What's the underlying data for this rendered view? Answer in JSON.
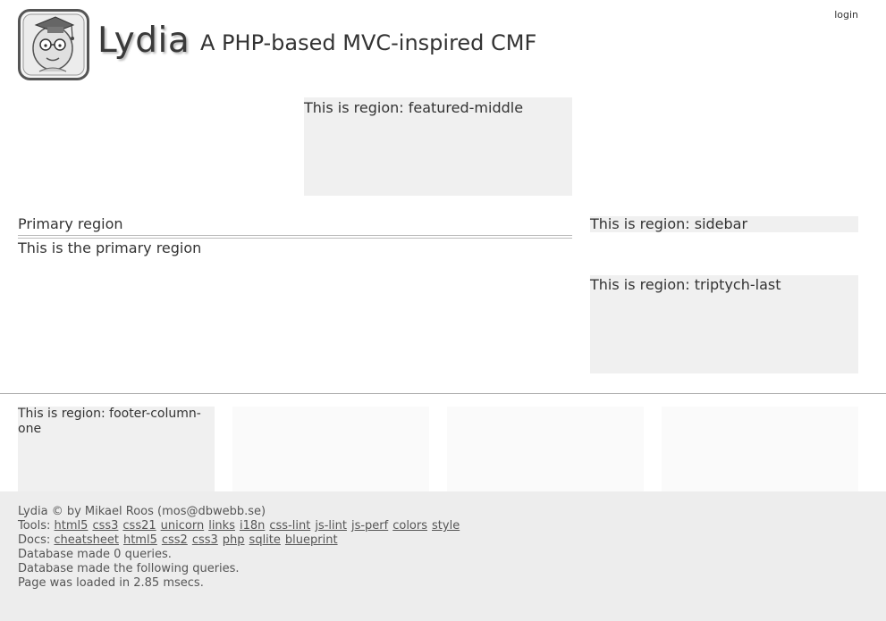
{
  "header": {
    "site_title": "Lydia",
    "slogan": "A PHP-based MVC-inspired CMF",
    "login_label": "login",
    "logo_icon": "graduate-face-logo-icon"
  },
  "regions": {
    "featured_middle": "This is region: featured-middle",
    "primary_title": "Primary region",
    "primary_content": "This is the primary region",
    "sidebar": "This is region: sidebar",
    "triptych_last": "This is region: triptych-last",
    "footer_column_one": "This is region: footer-column-one"
  },
  "footer": {
    "credit": "Lydia © by Mikael Roos (mos@dbwebb.se)",
    "tools_label": "Tools:",
    "tools_links": [
      "html5",
      "css3",
      "css21",
      "unicorn",
      "links",
      "i18n",
      "css-lint",
      "js-lint",
      "js-perf",
      "colors",
      "style"
    ],
    "docs_label": "Docs:",
    "docs_links": [
      "cheatsheet",
      "html5",
      "css2",
      "css3",
      "php",
      "sqlite",
      "blueprint"
    ],
    "db_queries_count": "Database made 0 queries.",
    "db_queries_list": "Database made the following queries.",
    "load_time": "Page was loaded in 2.85 msecs."
  },
  "colors": {
    "region_bg": "#f0f0f0",
    "footer_bg": "#ececec",
    "text": "#333333"
  }
}
